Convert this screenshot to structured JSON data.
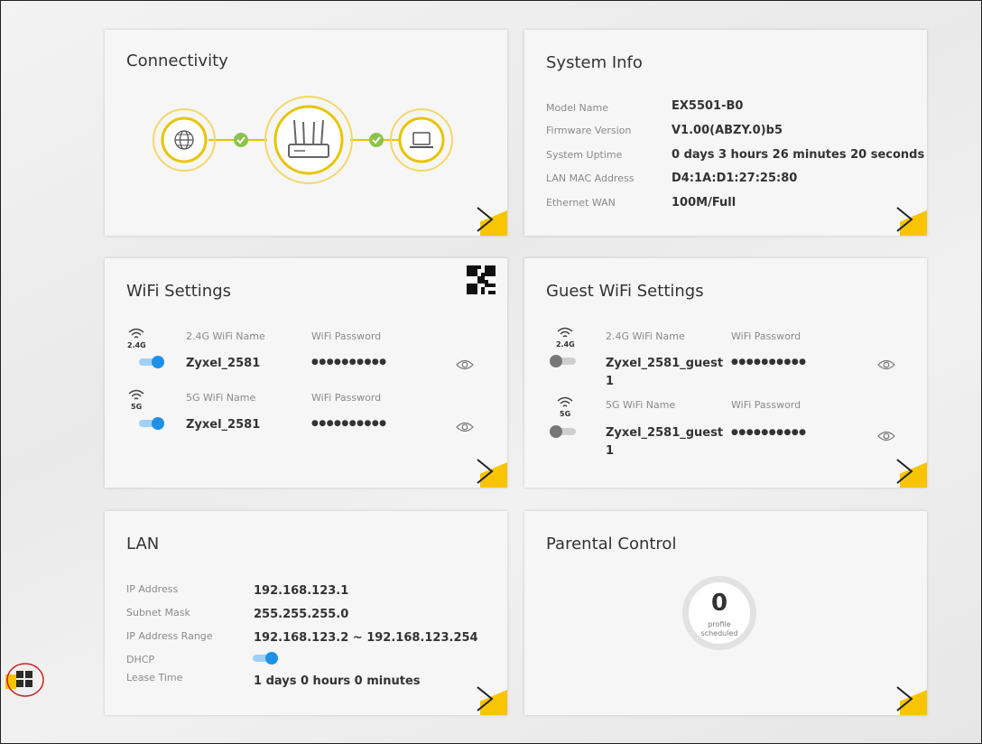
{
  "connectivity": {
    "title": "Connectivity"
  },
  "system_info": {
    "title": "System Info",
    "rows": [
      {
        "label": "Model Name",
        "value": "EX5501-B0"
      },
      {
        "label": "Firmware Version",
        "value": "V1.00(ABZY.0)b5"
      },
      {
        "label": "System Uptime",
        "value": "0 days 3 hours 26 minutes 20 seconds"
      },
      {
        "label": "LAN MAC Address",
        "value": "D4:1A:D1:27:25:80"
      },
      {
        "label": "Ethernet WAN",
        "value": "100M/Full"
      }
    ]
  },
  "wifi": {
    "title": "WiFi Settings",
    "band24": {
      "badge": "2.4G",
      "name_label": "2.4G WiFi Name",
      "pw_label": "WiFi Password",
      "name": "Zyxel_2581",
      "password": "●●●●●●●●●●",
      "enabled": true
    },
    "band5": {
      "badge": "5G",
      "name_label": "5G WiFi Name",
      "pw_label": "WiFi Password",
      "name": "Zyxel_2581",
      "password": "●●●●●●●●●●",
      "enabled": true
    }
  },
  "guest_wifi": {
    "title": "Guest WiFi Settings",
    "band24": {
      "badge": "2.4G",
      "name_label": "2.4G WiFi Name",
      "pw_label": "WiFi Password",
      "name_line1": "Zyxel_2581_guest",
      "name_line2": "1",
      "password": "●●●●●●●●●●",
      "enabled": false
    },
    "band5": {
      "badge": "5G",
      "name_label": "5G WiFi Name",
      "pw_label": "WiFi Password",
      "name_line1": "Zyxel_2581_guest",
      "name_line2": "1",
      "password": "●●●●●●●●●●",
      "enabled": false
    }
  },
  "lan": {
    "title": "LAN",
    "rows": [
      {
        "label": "IP Address",
        "value": "192.168.123.1"
      },
      {
        "label": "Subnet Mask",
        "value": "255.255.255.0"
      },
      {
        "label": "IP Address Range",
        "value": "192.168.123.2 ~ 192.168.123.254"
      },
      {
        "label": "DHCP",
        "value": ""
      },
      {
        "label": "Lease Time",
        "value": "1 days 0 hours 0 minutes"
      }
    ],
    "dhcp_enabled": true
  },
  "parental": {
    "title": "Parental Control",
    "count": "0",
    "caption_line1": "profile",
    "caption_line2": "scheduled"
  },
  "colors": {
    "accent": "#f8c400",
    "toggle_on": "#1e90e8",
    "toggle_off": "#777777",
    "check": "#8bc34a",
    "highlight_circle": "#cc2222"
  }
}
